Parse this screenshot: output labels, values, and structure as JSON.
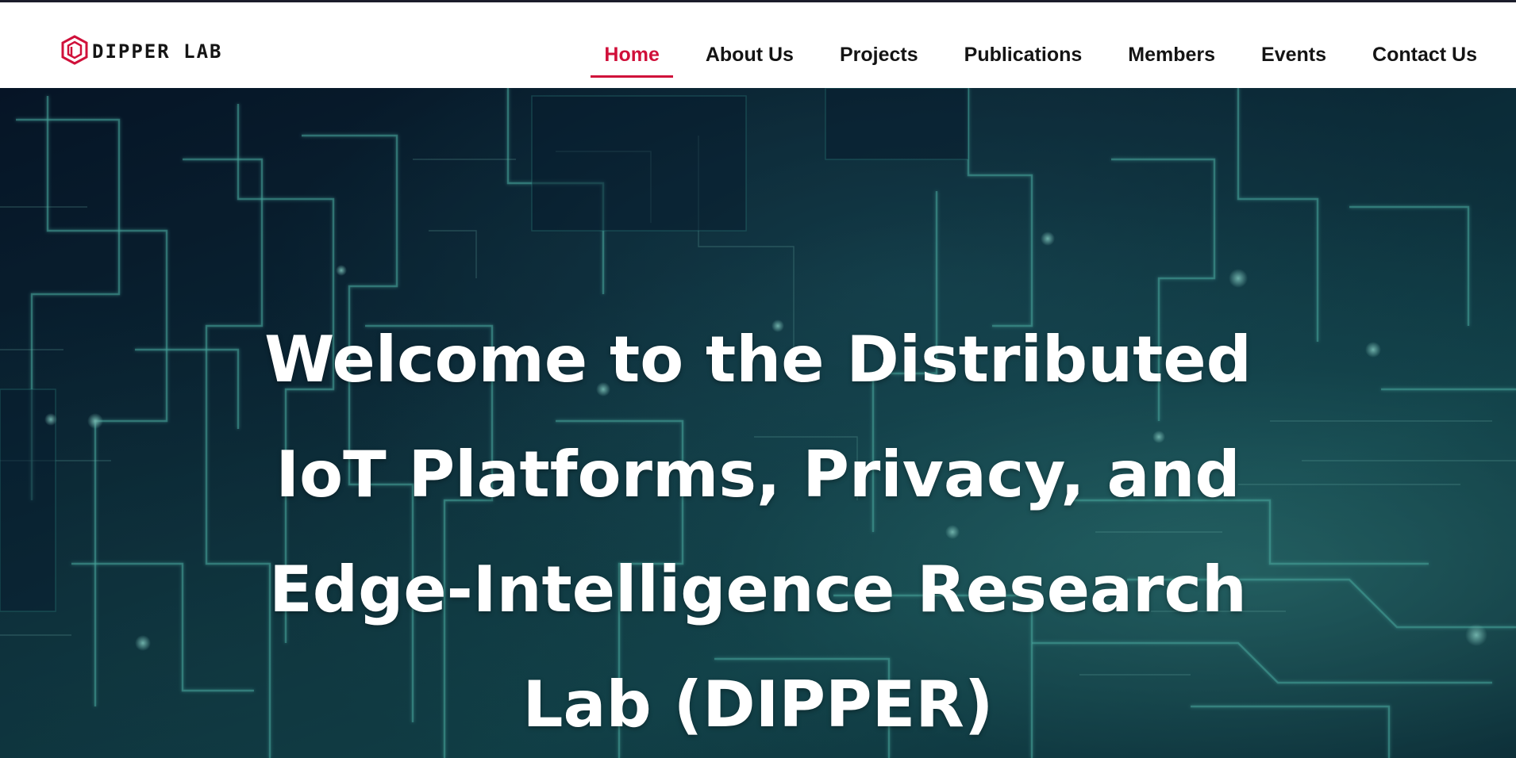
{
  "brand": {
    "logo_text": "DIPPER LAB",
    "accent_color": "#d0103a"
  },
  "nav": {
    "items": [
      {
        "label": "Home",
        "active": true
      },
      {
        "label": "About Us",
        "active": false
      },
      {
        "label": "Projects",
        "active": false
      },
      {
        "label": "Publications",
        "active": false
      },
      {
        "label": "Members",
        "active": false
      },
      {
        "label": "Events",
        "active": false
      },
      {
        "label": "Contact Us",
        "active": false
      }
    ]
  },
  "hero": {
    "title": "Welcome to the Distributed IoT Platforms, Privacy, and Edge-Intelligence Research Lab (DIPPER)",
    "background": "circuit-board-image",
    "text_color": "#ffffff"
  }
}
